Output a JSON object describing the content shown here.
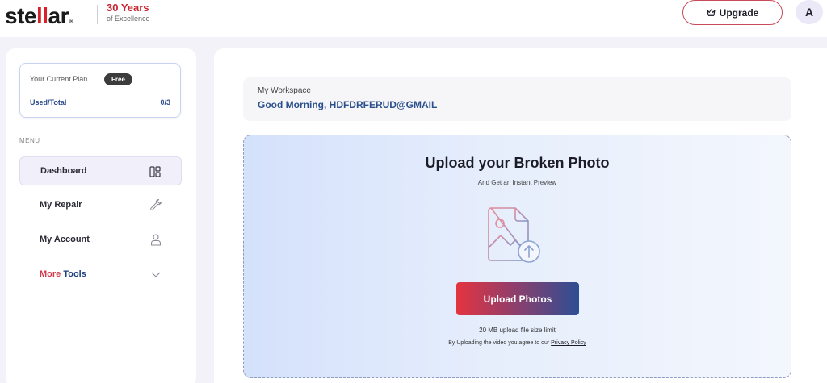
{
  "brand": {
    "logo_parts": [
      "ste",
      "ll",
      "ar"
    ],
    "reg_mark": "®",
    "anniversary_title": "30 Years",
    "anniversary_sub": "of Excellence"
  },
  "header": {
    "upgrade_label": "Upgrade",
    "avatar_initial": "A"
  },
  "plan": {
    "label": "Your Current Plan",
    "badge": "Free",
    "used_label": "Used/Total",
    "used_value": "0/3"
  },
  "sidebar": {
    "menu_label": "MENU",
    "items": [
      {
        "label": "Dashboard",
        "icon": "dashboard-icon"
      },
      {
        "label": "My Repair",
        "icon": "wrench-icon"
      },
      {
        "label": "My Account",
        "icon": "user-icon"
      }
    ],
    "more_tools": {
      "part1": "More ",
      "part2": "Tools",
      "icon": "chevron-down-icon"
    }
  },
  "workspace": {
    "label": "My Workspace",
    "greeting": "Good Morning, HDFDRFERUD@GMAIL"
  },
  "upload": {
    "title": "Upload your Broken Photo",
    "subtitle": "And Get an Instant Preview",
    "button_label": "Upload Photos",
    "limit_text": "20 MB upload file size limit",
    "agree_prefix": "By Uploading the video you agree to our",
    "privacy_link": "Privacy Policy"
  },
  "colors": {
    "brand_red": "#d7222a",
    "brand_blue": "#2b4f8d",
    "button_gradient_start": "#e4343f",
    "button_gradient_end": "#2c4f94"
  }
}
